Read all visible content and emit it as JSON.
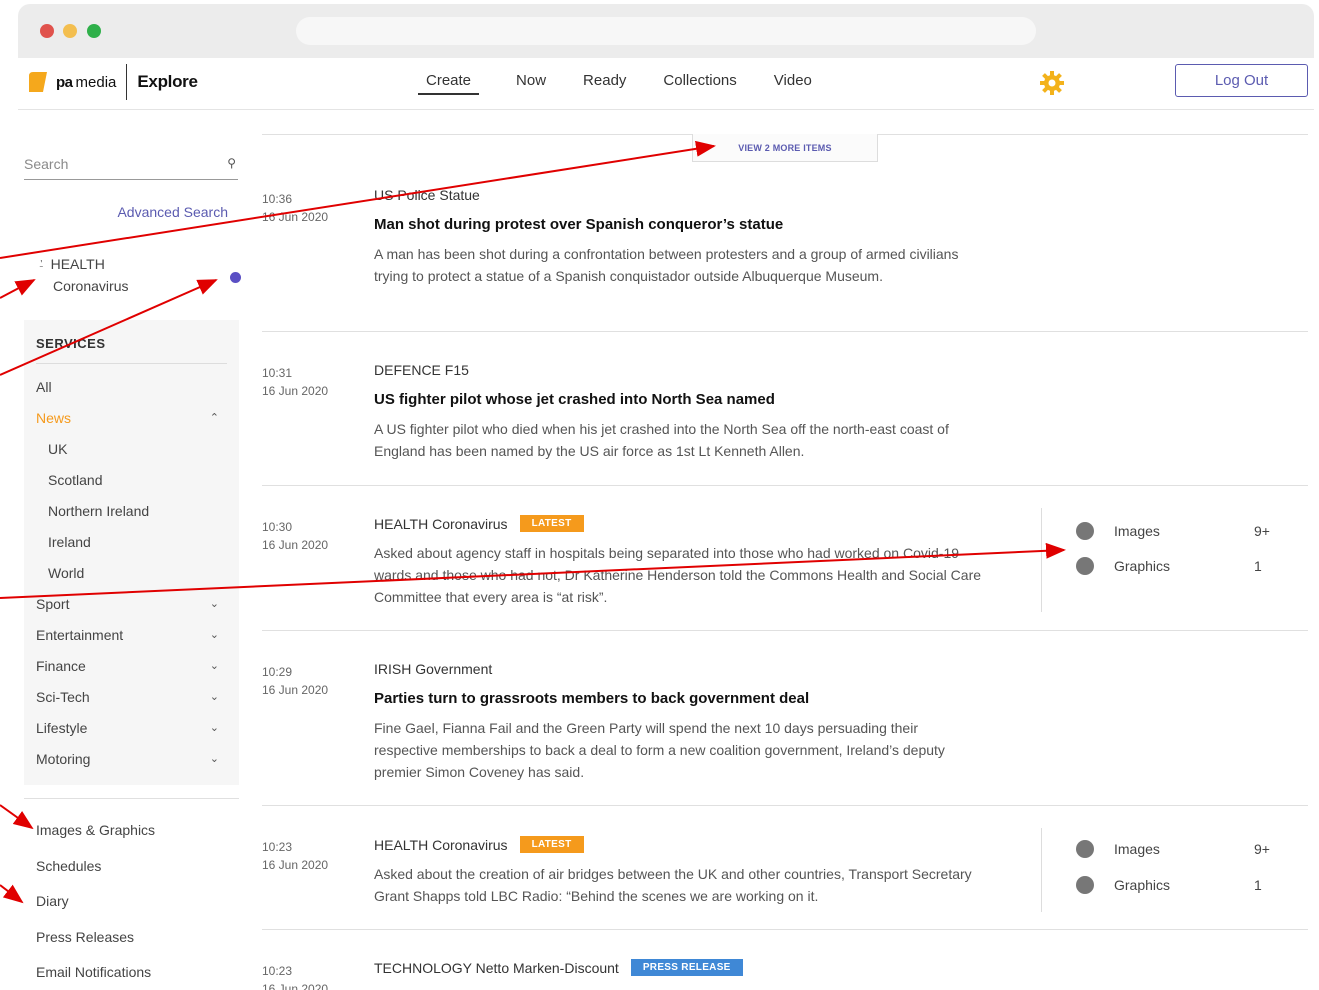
{
  "browser": {
    "url": ""
  },
  "header": {
    "logo_pa": "pa",
    "logo_media": "media",
    "logo_explore": "Explore",
    "nav": [
      "Create",
      "Now",
      "Ready",
      "Collections",
      "Video"
    ],
    "active_nav": "Create",
    "logout_label": "Log Out",
    "settings_icon": "gear-icon",
    "accent": "#5b5bb0",
    "gear_color": "#f3b21b"
  },
  "sidebar": {
    "search_placeholder": "Search",
    "advanced_search": "Advanced Search",
    "pinned": {
      "category": "HEALTH",
      "topic": "Coronavirus"
    },
    "services_title": "SERVICES",
    "services": [
      {
        "label": "All"
      },
      {
        "label": "News",
        "active": true,
        "chevron": "up"
      },
      {
        "label": "UK",
        "sub": true
      },
      {
        "label": "Scotland",
        "sub": true
      },
      {
        "label": "Northern Ireland",
        "sub": true
      },
      {
        "label": "Ireland",
        "sub": true
      },
      {
        "label": "World",
        "sub": true
      },
      {
        "label": "Sport",
        "chevron": "down"
      },
      {
        "label": "Entertainment",
        "chevron": "down"
      },
      {
        "label": "Finance",
        "chevron": "down"
      },
      {
        "label": "Sci-Tech",
        "chevron": "down"
      },
      {
        "label": "Lifestyle",
        "chevron": "down"
      },
      {
        "label": "Motoring",
        "chevron": "down"
      }
    ],
    "links": [
      "Images & Graphics",
      "Schedules",
      "Diary",
      "Press Releases",
      "Email Notifications"
    ],
    "active_color": "#f59a1c"
  },
  "feed": {
    "view_more": "VIEW 2 MORE ITEMS",
    "items": [
      {
        "time": "10:36",
        "date": "16 Jun 2020",
        "tag": "US Police Statue",
        "headline": "Man shot during protest over Spanish conqueror’s statue",
        "summary": "A man has been shot during a confrontation between protesters and a group of armed civilians trying to protect a statue of a Spanish conquistador outside Albuquerque Museum."
      },
      {
        "time": "10:31",
        "date": "16 Jun 2020",
        "tag": "DEFENCE F15",
        "headline": "US fighter pilot whose jet crashed into North Sea named",
        "summary": "A US fighter pilot who died when his jet crashed into the North Sea off the north-east coast of England has been named by the US air force as 1st Lt Kenneth Allen."
      },
      {
        "time": "10:30",
        "date": "16 Jun 2020",
        "tag": "HEALTH Coronavirus",
        "badge": "LATEST",
        "summary": "Asked about agency staff in hospitals being separated into those who had worked on Covid-19 wards and those who had not, Dr Katherine Henderson told the Commons Health and Social Care Committee that every area is “at risk”.",
        "media": [
          {
            "label": "Images",
            "count": "9+"
          },
          {
            "label": "Graphics",
            "count": "1"
          }
        ]
      },
      {
        "time": "10:29",
        "date": "16 Jun 2020",
        "tag": "IRISH Government",
        "headline": "Parties turn to grassroots members to back government deal",
        "summary": "Fine Gael, Fianna Fail and the Green Party will spend the next 10 days persuading their respective memberships to back a deal to form a new coalition government, Ireland’s deputy premier Simon Coveney has said."
      },
      {
        "time": "10:23",
        "date": "16 Jun 2020",
        "tag": "HEALTH Coronavirus",
        "badge": "LATEST",
        "summary": "Asked about the creation of air bridges between the UK and other countries, Transport Secretary Grant Shapps told LBC Radio: “Behind the scenes we are working on it.",
        "media": [
          {
            "label": "Images",
            "count": "9+"
          },
          {
            "label": "Graphics",
            "count": "1"
          }
        ]
      },
      {
        "time": "10:23",
        "date": "16 Jun 2020",
        "tag": "TECHNOLOGY Netto Marken-Discount",
        "badge": "PRESS RELEASE"
      }
    ],
    "badge_colors": {
      "LATEST": "#f59a1c",
      "PRESS RELEASE": "#3f88d6"
    }
  },
  "annotations": {
    "arrow_color": "#e00000"
  }
}
